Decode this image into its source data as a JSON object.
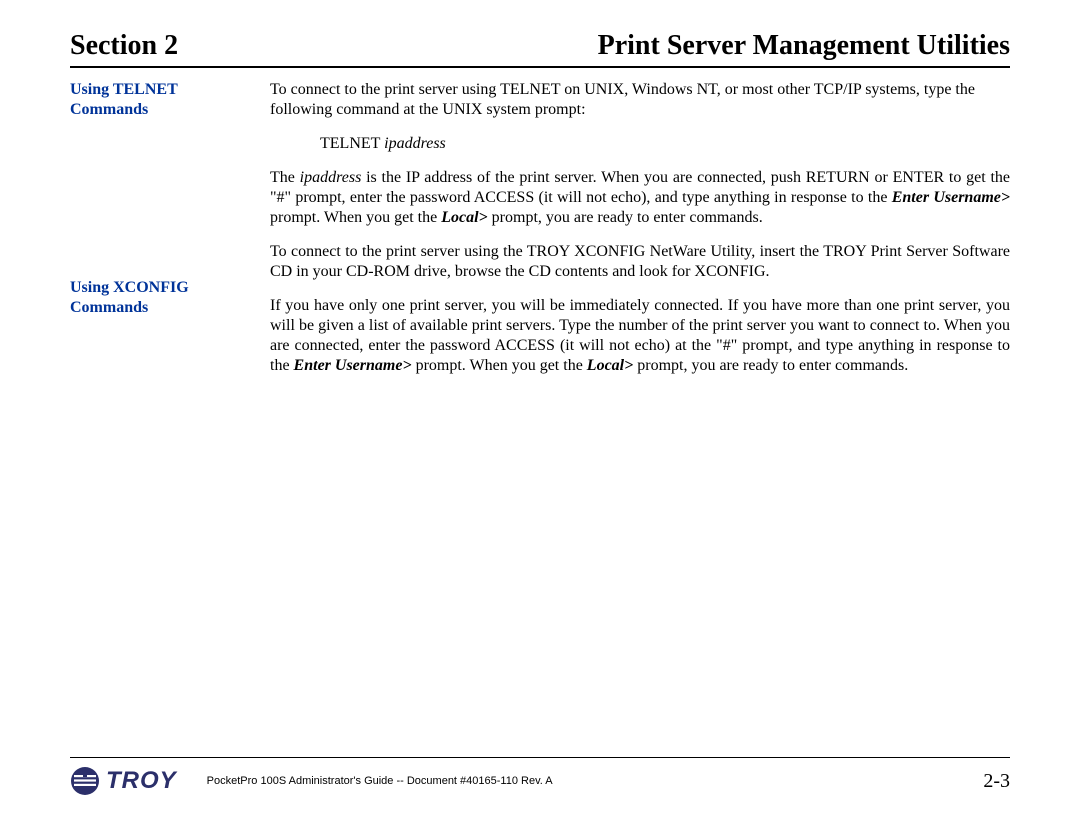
{
  "header": {
    "left": "Section 2",
    "right": "Print Server Management Utilities"
  },
  "sidebar": {
    "telnet": {
      "line1": "Using TELNET",
      "line2": "Commands"
    },
    "xconfig": {
      "line1": "Using XCONFIG",
      "line2": "Commands"
    }
  },
  "content": {
    "telnet_intro": "To connect to the print server using TELNET on UNIX, Windows NT, or most other TCP/IP systems, type the following command at the UNIX system prompt:",
    "telnet_cmd_static": "TELNET ",
    "telnet_cmd_italic": "ipaddress",
    "telnet_para2_a": "The ",
    "telnet_para2_b": "ipaddress",
    "telnet_para2_c": " is the IP address of the print server.  When you are connected, push RETURN or ENTER to get the \"#\" prompt, enter the password ACCESS (it will not echo), and type anything in response to the ",
    "telnet_para2_d": "Enter Username>",
    "telnet_para2_e": " prompt.  When you get the ",
    "telnet_para2_f": "Local>",
    "telnet_para2_g": " prompt, you are ready to enter commands.",
    "xconfig_p1": "To connect to the print server using the TROY XCONFIG NetWare Utility, insert the TROY Print Server Software CD in your CD-ROM drive, browse the CD contents and look for XCONFIG.",
    "xconfig_p2_a": "If you have only one print server, you will be immediately connected.  If you have more than one print server, you will be given a list of available print servers.  Type the number of the print server you want to connect to.  When you are connected, enter the password ACCESS (it will not echo) at the \"#\" prompt, and type anything in response to the ",
    "xconfig_p2_b": "Enter Username>",
    "xconfig_p2_c": " prompt.  When you get the ",
    "xconfig_p2_d": "Local>",
    "xconfig_p2_e": " prompt, you are ready to enter commands."
  },
  "footer": {
    "doc": "PocketPro 100S Administrator's Guide -- Document #40165-110  Rev. A",
    "page": "2-3",
    "logo_text": "TROY"
  }
}
